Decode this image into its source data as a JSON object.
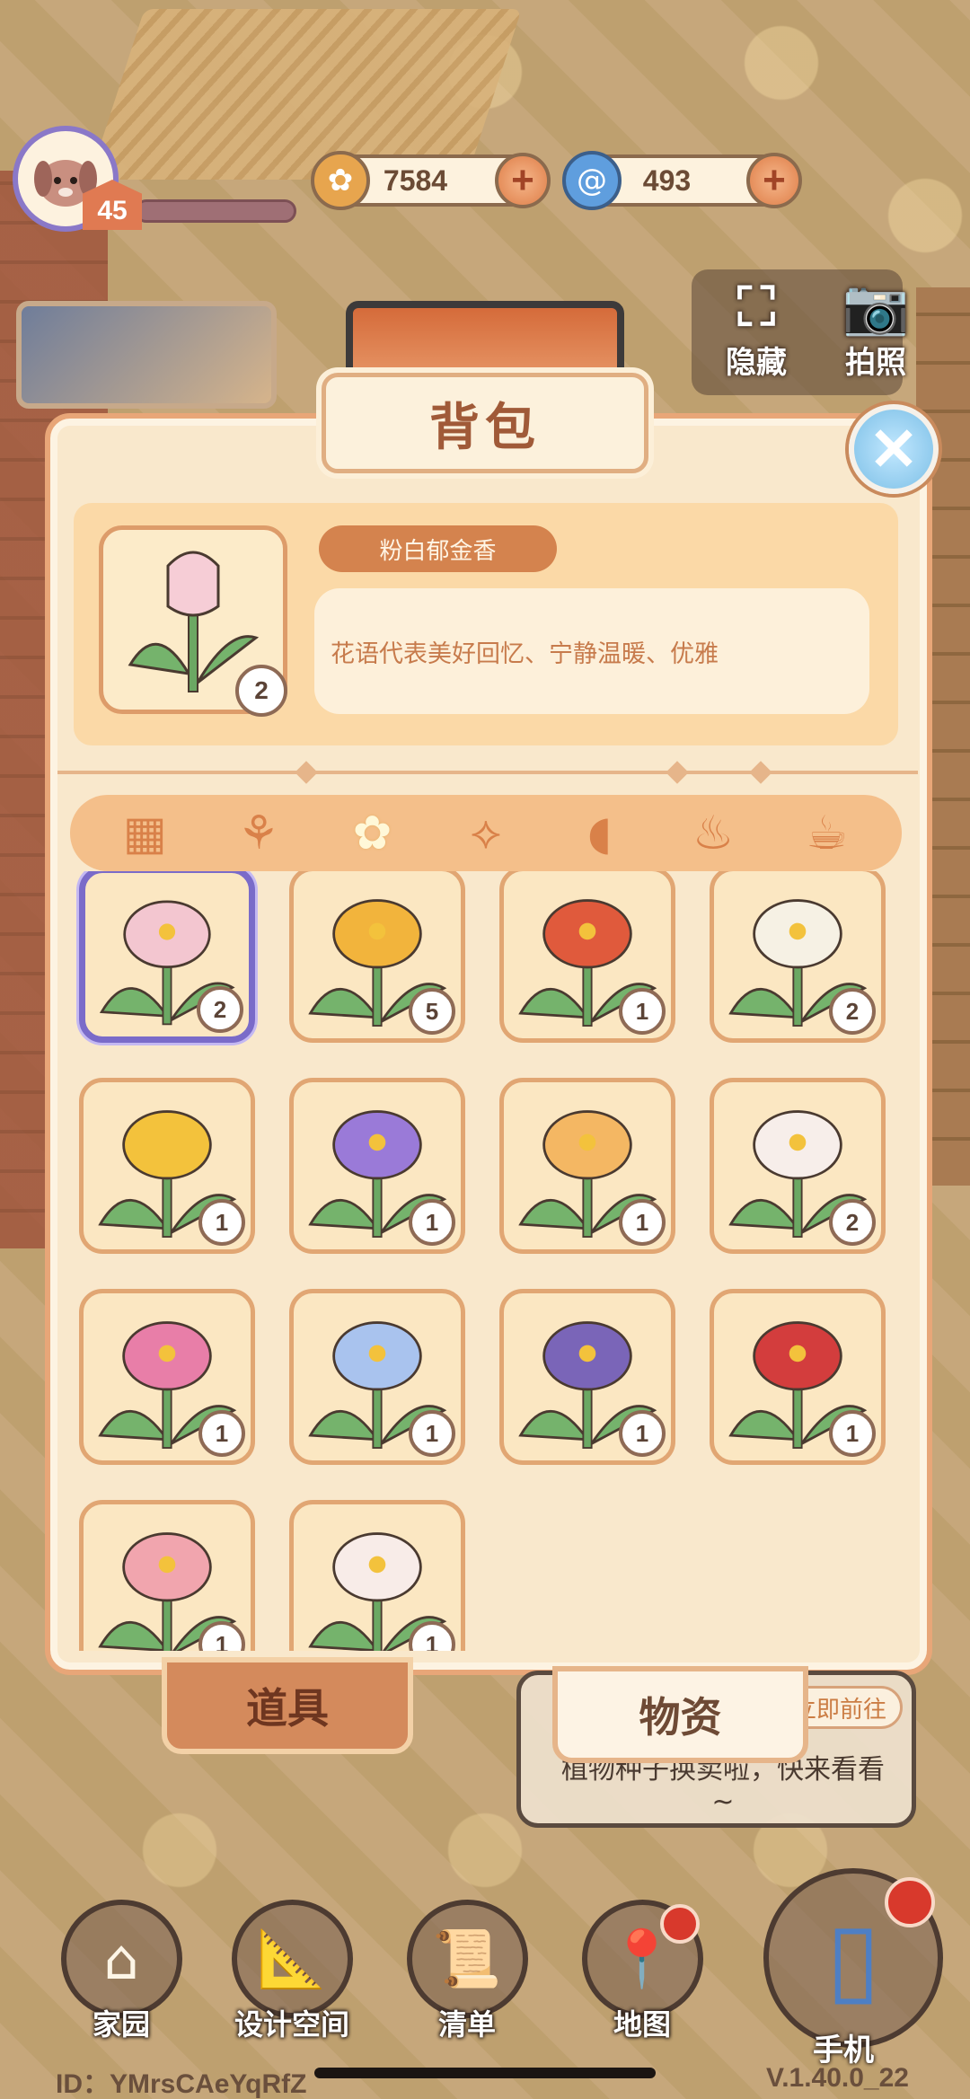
{
  "hud": {
    "level": "45",
    "coins": "7584",
    "gems": "493",
    "hide_label": "隐藏",
    "photo_label": "拍照"
  },
  "panel": {
    "title": "背包",
    "selected_item": {
      "name": "粉白郁金香",
      "description": "花语代表美好回忆、宁静温暖、优雅",
      "count": "2"
    },
    "categories": [
      {
        "icon": "grid-icon"
      },
      {
        "icon": "seedling-icon"
      },
      {
        "icon": "flower-icon"
      },
      {
        "icon": "fish-icon"
      },
      {
        "icon": "drumstick-icon"
      },
      {
        "icon": "bowl-icon"
      },
      {
        "icon": "teacup-icon"
      }
    ],
    "items": [
      {
        "name": "pink-white-tulip",
        "count": "2",
        "color": "#f3c6d0"
      },
      {
        "name": "yellow-flower",
        "count": "5",
        "color": "#f2b43c"
      },
      {
        "name": "red-flower-cluster",
        "count": "1",
        "color": "#e05a3c"
      },
      {
        "name": "white-yellow-narcissus",
        "count": "2",
        "color": "#f6f1e4"
      },
      {
        "name": "yellow-daffodil",
        "count": "1",
        "color": "#f3c23c"
      },
      {
        "name": "purple-lotus",
        "count": "1",
        "color": "#9a7ad8"
      },
      {
        "name": "orange-lotus",
        "count": "1",
        "color": "#f4b763"
      },
      {
        "name": "white-anthurium",
        "count": "2",
        "color": "#f7eeea"
      },
      {
        "name": "pink-lotus",
        "count": "1",
        "color": "#e87ea8"
      },
      {
        "name": "blue-rose",
        "count": "1",
        "color": "#a9c3ee"
      },
      {
        "name": "purple-hyacinth",
        "count": "1",
        "color": "#7a65b8"
      },
      {
        "name": "red-lotus",
        "count": "1",
        "color": "#d33d3d"
      },
      {
        "name": "pink-tulip",
        "count": "1",
        "color": "#f1a5ae"
      },
      {
        "name": "white-tulip",
        "count": "1",
        "color": "#f8ece8"
      }
    ]
  },
  "tabs": {
    "tools": "道具",
    "materials": "物资"
  },
  "notice": {
    "goto": "立即前往",
    "line1": "植物种子换卖啦，快来看看",
    "line2": "~"
  },
  "nav": {
    "home": "家园",
    "design": "设计空间",
    "list": "清单",
    "map": "地图",
    "phone": "手机"
  },
  "footer": {
    "id": "ID：YMrsCAeYqRfZ",
    "version": "V.1.40.0_22"
  },
  "colors": {
    "panel_bg": "#f9e8cc",
    "accent": "#d4834e",
    "selected_border": "#7a6bc9"
  }
}
